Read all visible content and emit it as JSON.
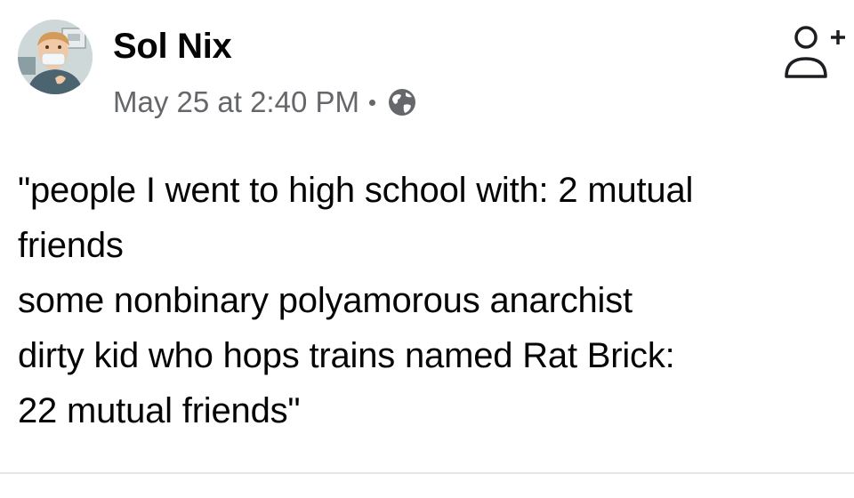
{
  "post": {
    "author": {
      "name": "Sol Nix"
    },
    "timestamp": "May 25 at 2:40 PM",
    "audience_icon": "globe-icon",
    "action_icon": "add-friend-icon",
    "text_lines": [
      "\"people I went to high school with: 2 mutual",
      "friends",
      "some nonbinary polyamorous anarchist",
      "dirty kid who hops trains named Rat Brick:",
      "22 mutual friends\""
    ]
  },
  "colors": {
    "text": "#050505",
    "meta": "#65676b",
    "icon": "#65676b",
    "divider": "#e4e6eb"
  }
}
